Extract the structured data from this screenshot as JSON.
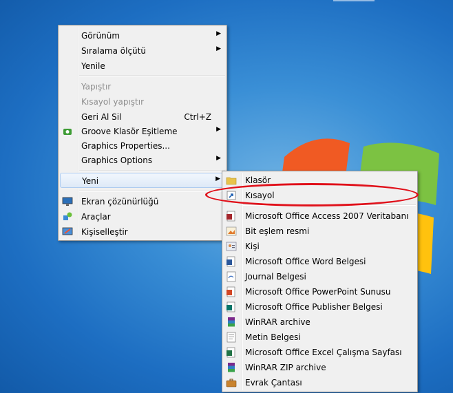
{
  "context_menu": {
    "items": [
      {
        "label": "Görünüm",
        "submenu": true
      },
      {
        "label": "Sıralama ölçütü",
        "submenu": true
      },
      {
        "label": "Yenile"
      },
      {
        "label": "Yapıştır",
        "disabled": true
      },
      {
        "label": "Kısayol yapıştır",
        "disabled": true
      },
      {
        "label": "Geri Al Sil",
        "shortcut": "Ctrl+Z"
      },
      {
        "label": "Groove Klasör Eşitleme",
        "submenu": true,
        "icon": "groove-icon"
      },
      {
        "label": "Graphics Properties..."
      },
      {
        "label": "Graphics Options",
        "submenu": true
      },
      {
        "label": "Yeni",
        "submenu": true,
        "highlighted": true
      },
      {
        "label": "Ekran çözünürlüğü",
        "icon": "display-icon"
      },
      {
        "label": "Araçlar",
        "icon": "tools-icon"
      },
      {
        "label": "Kişiselleştir",
        "icon": "personalize-icon"
      }
    ]
  },
  "new_submenu": {
    "items": [
      {
        "label": "Klasör",
        "icon": "folder-icon"
      },
      {
        "label": "Kısayol",
        "icon": "shortcut-icon"
      },
      {
        "label": "Microsoft Office Access 2007 Veritabanı",
        "icon": "access-icon"
      },
      {
        "label": "Bit eşlem resmi",
        "icon": "bitmap-icon"
      },
      {
        "label": "Kişi",
        "icon": "contact-icon"
      },
      {
        "label": "Microsoft Office Word Belgesi",
        "icon": "word-icon"
      },
      {
        "label": "Journal Belgesi",
        "icon": "journal-icon"
      },
      {
        "label": "Microsoft Office PowerPoint Sunusu",
        "icon": "powerpoint-icon"
      },
      {
        "label": "Microsoft Office Publisher Belgesi",
        "icon": "publisher-icon"
      },
      {
        "label": "WinRAR archive",
        "icon": "winrar-icon"
      },
      {
        "label": "Metin Belgesi",
        "icon": "text-document-icon"
      },
      {
        "label": "Microsoft Office Excel Çalışma Sayfası",
        "icon": "excel-icon"
      },
      {
        "label": "WinRAR ZIP archive",
        "icon": "winrar-zip-icon"
      },
      {
        "label": "Evrak Çantası",
        "icon": "briefcase-icon"
      }
    ]
  },
  "annotation": {
    "color": "#e0101a",
    "target": "Kısayol"
  },
  "colors": {
    "menu_bg": "#f0f0f0",
    "highlight": "#dde9f7",
    "desktop": "#1d6ec2"
  }
}
